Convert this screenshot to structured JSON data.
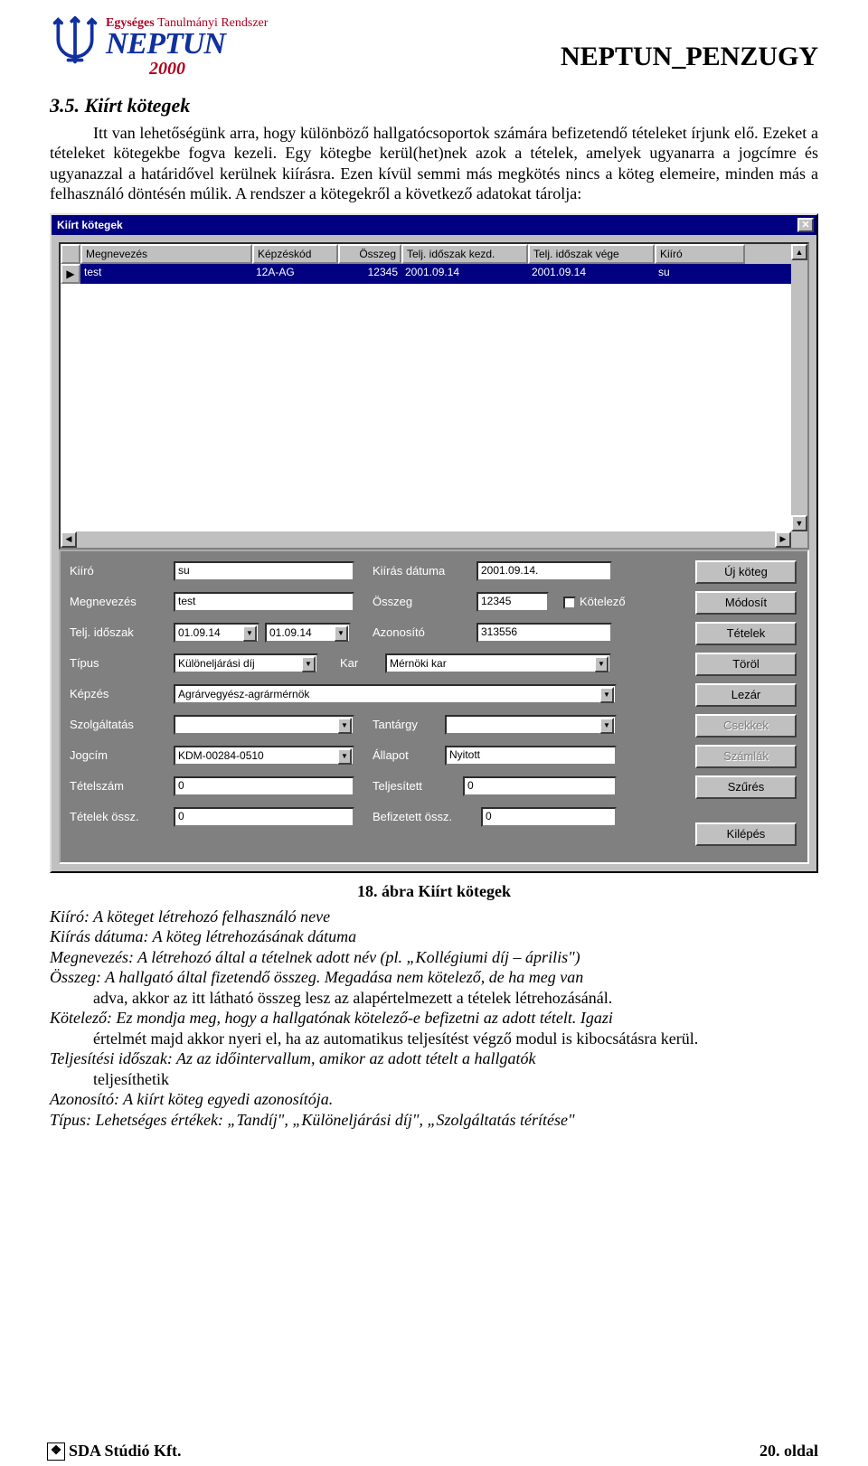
{
  "header": {
    "logo_line1": "Egységes",
    "logo_line2": "Tanulmányi Rendszer",
    "logo_name": "NEPTUN",
    "logo_year": "2000",
    "doc_title": "NEPTUN_PENZUGY"
  },
  "section_title": "3.5. Kiírt kötegek",
  "intro": "Itt van lehetőségünk arra, hogy különböző hallgatócsoportok számára befizetendő tételeket írjunk elő. Ezeket a tételeket kötegekbe fogva kezeli. Egy kötegbe kerül(het)nek azok a tételek, amelyek ugyanarra a jogcímre és ugyanazzal a határidővel kerülnek kiírásra. Ezen kívül semmi más megkötés nincs a köteg elemeire, minden más a felhasználó döntésén múlik. A rendszer a kötegekről a következő adatokat tárolja:",
  "dialog": {
    "title": "Kiírt kötegek",
    "columns": [
      "Megnevezés",
      "Képzéskód",
      "Összeg",
      "Telj. időszak kezd.",
      "Telj. időszak vége",
      "Kiíró"
    ],
    "row": {
      "megnevezes": "test",
      "kepzeskod": "12A-AG",
      "osszeg": "12345",
      "kezd": "2001.09.14",
      "vege": "2001.09.14",
      "kiiro": "su"
    },
    "fields": {
      "kiiro_lbl": "Kiíró",
      "kiiro": "su",
      "kiiras_datuma_lbl": "Kiírás dátuma",
      "kiiras_datuma": "2001.09.14.",
      "megnevezes_lbl": "Megnevezés",
      "megnevezes": "test",
      "osszeg_lbl": "Összeg",
      "osszeg": "12345",
      "kotelezo_lbl": "Kötelező",
      "telj_lbl": "Telj. időszak",
      "telj_from": "01.09.14",
      "telj_to": "01.09.14",
      "azonosito_lbl": "Azonosító",
      "azonosito": "313556",
      "tipus_lbl": "Típus",
      "tipus": "Különeljárási díj",
      "kar_lbl": "Kar",
      "kar": "Mérnöki kar",
      "kepzes_lbl": "Képzés",
      "kepzes": "Agrárvegyész-agrármérnök",
      "szolg_lbl": "Szolgáltatás",
      "szolg": "",
      "tantargy_lbl": "Tantárgy",
      "tantargy": "",
      "jogcim_lbl": "Jogcím",
      "jogcim": "KDM-00284-0510",
      "allapot_lbl": "Állapot",
      "allapot": "Nyitott",
      "tetelszam_lbl": "Tételszám",
      "tetelszam": "0",
      "teljesitett_lbl": "Teljesített",
      "teljesitett": "0",
      "tetelek_ossz_lbl": "Tételek össz.",
      "tetelek_ossz": "0",
      "befizetett_lbl": "Befizetett össz.",
      "befizetett": "0"
    },
    "buttons": {
      "uj": "Új köteg",
      "modosit": "Módosít",
      "tetelek": "Tételek",
      "torol": "Töröl",
      "lezar": "Lezár",
      "csekkek": "Csekkek",
      "szamlak": "Számlák",
      "szures": "Szűrés",
      "kilepes": "Kilépés"
    }
  },
  "caption": "18. ábra Kiírt kötegek",
  "defs": {
    "d1": "Kiíró: A köteget létrehozó felhasználó neve",
    "d2": "Kiírás dátuma: A köteg létrehozásának dátuma",
    "d3": "Megnevezés: A létrehozó által a tételnek adott név (pl. „Kollégiumi díj – április\")",
    "d4a": "Összeg: A hallgató által fizetendő összeg. Megadása nem kötelező, de ha meg van",
    "d4b": "adva, akkor az itt látható összeg lesz az alapértelmezett a tételek létrehozásánál.",
    "d5a": "Kötelező: Ez mondja meg, hogy a hallgatónak kötelező-e befizetni az adott tételt. Igazi",
    "d5b": "értelmét majd akkor nyeri el, ha az automatikus teljesítést végző modul is kibocsátásra kerül.",
    "d6a": "Teljesítési időszak: Az az időintervallum, amikor az adott tételt a hallgatók",
    "d6b": "teljesíthetik",
    "d7": "Azonosító: A kiírt köteg egyedi azonosítója.",
    "d8": "Típus: Lehetséges értékek: „Tandíj\", „Különeljárási díj\", „Szolgáltatás térítése\""
  },
  "footer": {
    "company": "SDA Stúdió Kft.",
    "page": "20. oldal"
  }
}
